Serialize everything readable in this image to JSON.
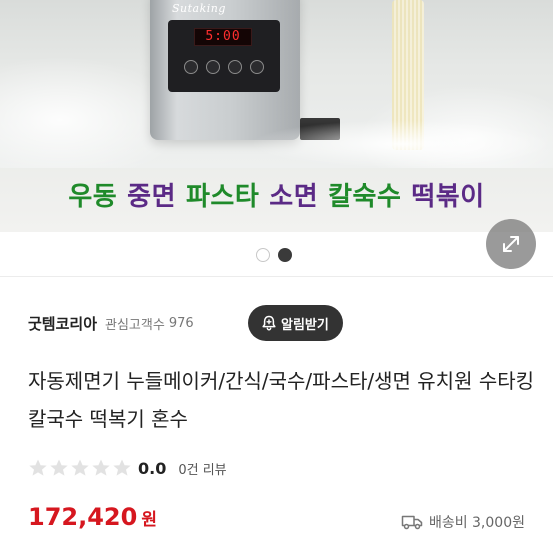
{
  "hero": {
    "machine_brand": "Sutaking",
    "display_time": "5:00",
    "caption_words": [
      {
        "text": "우동",
        "color": "#1f8a2a"
      },
      {
        "text": "중면",
        "color": "#5b2a86"
      },
      {
        "text": "파스타",
        "color": "#1f8a2a"
      },
      {
        "text": "소면",
        "color": "#5b2a86"
      },
      {
        "text": "칼숙수",
        "color": "#1f8a2a"
      },
      {
        "text": "떡볶이",
        "color": "#5b2a86"
      }
    ],
    "slide_current": 2,
    "slide_total": 2,
    "expand_icon": "expand-arrows-icon"
  },
  "seller": {
    "name": "굿템코리아",
    "followers_label": "관심고객수",
    "followers_count": "976",
    "alarm_button_label": "알림받기",
    "alarm_icon": "bell-plus-icon"
  },
  "product": {
    "title": "자동제면기 누들메이커/간식/국수/파스타/생면 유치원 수타킹 칼국수 떡복기 혼수"
  },
  "rating": {
    "score": "0.0",
    "review_count_text": "0건 리뷰",
    "stars_filled": 0,
    "stars_total": 5
  },
  "price": {
    "amount": "172,420",
    "unit": "원",
    "color": "#d6171f"
  },
  "shipping": {
    "label": "배송비 3,000원",
    "icon": "truck-icon"
  }
}
